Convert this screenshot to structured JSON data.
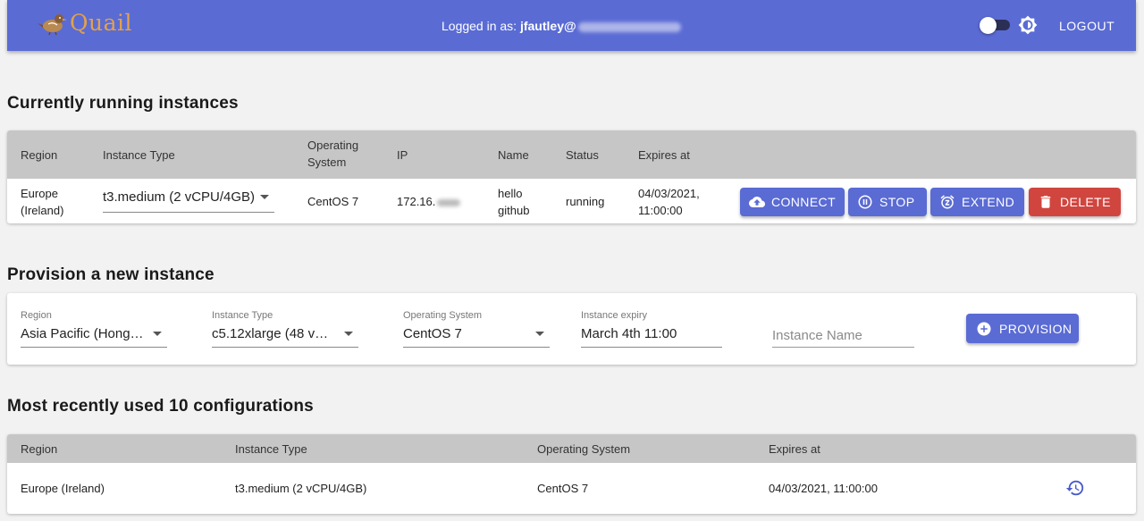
{
  "header": {
    "logo_text": "Quail",
    "login_prefix": "Logged in as: ",
    "login_user": "jfautley@",
    "logout_label": "LOGOUT"
  },
  "running": {
    "title": "Currently running instances",
    "columns": [
      "Region",
      "Instance Type",
      "Operating System",
      "IP",
      "Name",
      "Status",
      "Expires at"
    ],
    "row": {
      "region": "Europe (Ireland)",
      "instance_type": "t3.medium (2 vCPU/4GB)",
      "os": "CentOS 7",
      "ip": "172.16.",
      "name": "hello github",
      "status": "running",
      "expires": "04/03/2021, 11:00:00"
    },
    "actions": {
      "connect": "CONNECT",
      "stop": "STOP",
      "extend": "EXTEND",
      "delete": "DELETE"
    }
  },
  "provision": {
    "title": "Provision a new instance",
    "region_label": "Region",
    "region_value": "Asia Pacific (Hong…",
    "type_label": "Instance Type",
    "type_value": "c5.12xlarge (48 v…",
    "os_label": "Operating System",
    "os_value": "CentOS 7",
    "expiry_label": "Instance expiry",
    "expiry_value": "March 4th 11:00",
    "name_placeholder": "Instance Name",
    "button_label": "PROVISION"
  },
  "recent": {
    "title": "Most recently used 10 configurations",
    "columns": [
      "Region",
      "Instance Type",
      "Operating System",
      "Expires at"
    ],
    "row": {
      "region": "Europe (Ireland)",
      "instance_type": "t3.medium (2 vCPU/4GB)",
      "os": "CentOS 7",
      "expires": "04/03/2021, 11:00:00"
    }
  },
  "colors": {
    "primary": "#5a6bd4",
    "danger": "#d0463f",
    "logo": "#e3a24a",
    "table_header": "#c6c6c6"
  },
  "icons": [
    "quail-logo-icon",
    "brightness-icon",
    "cloud-upload-icon",
    "pause-circle-icon",
    "snooze-icon",
    "trash-icon",
    "add-circle-icon",
    "history-icon",
    "chevron-down-icon"
  ]
}
